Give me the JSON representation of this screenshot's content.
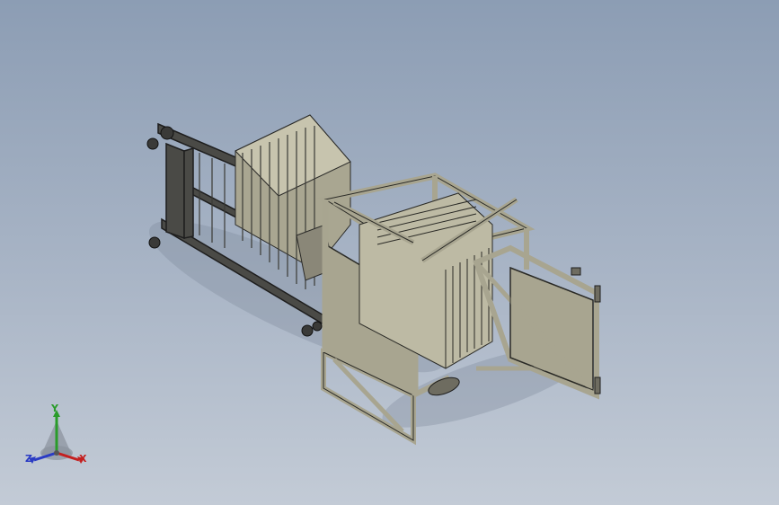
{
  "viewport": {
    "background_top": "#8c9db4",
    "background_bottom": "#c3cbd6",
    "model_color": "#b3b09a",
    "model_shade": "#8f8c78",
    "edge_color": "#222222"
  },
  "triad": {
    "x_label": "X",
    "y_label": "Y",
    "z_label": "Z",
    "x_color": "#c42020",
    "y_color": "#2a9c2a",
    "z_color": "#2a3bc4"
  }
}
